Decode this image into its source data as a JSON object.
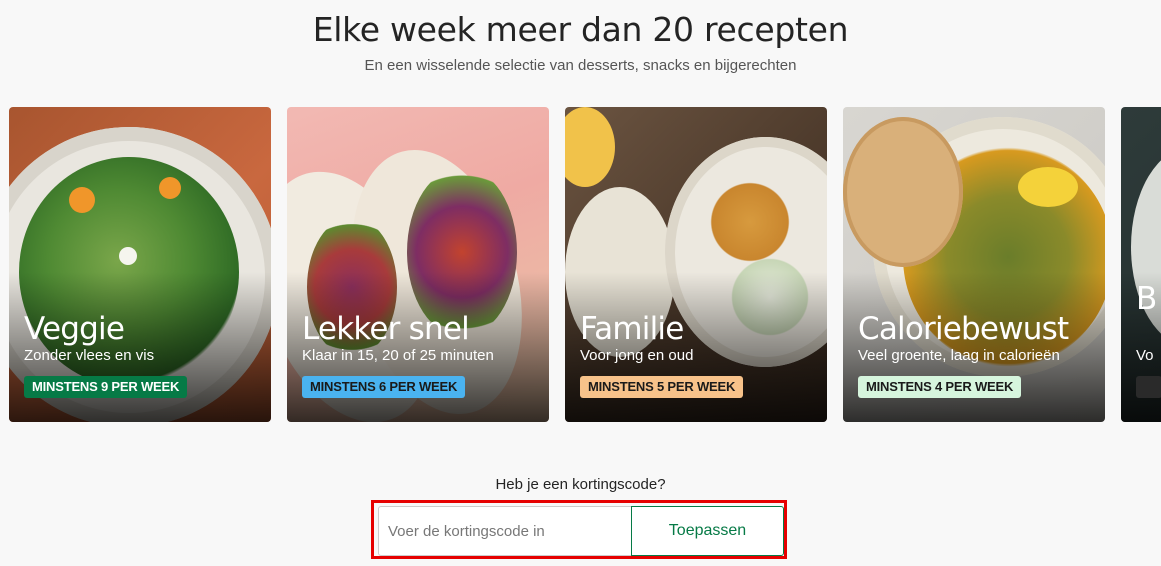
{
  "heading": "Elke week meer dan 20 recepten",
  "subheading": "En een wisselende selectie van desserts, snacks en bijgerechten",
  "cards": [
    {
      "title": "Veggie",
      "description": "Zonder vlees en vis",
      "badge": "MINSTENS 9 PER WEEK",
      "badge_bg": "#067a46",
      "badge_fg": "#ffffff"
    },
    {
      "title": "Lekker snel",
      "description": "Klaar in 15, 20 of 25 minuten",
      "badge": "MINSTENS 6 PER WEEK",
      "badge_bg": "#4ab3f0",
      "badge_fg": "#1a1a1a"
    },
    {
      "title": "Familie",
      "description": "Voor jong en oud",
      "badge": "MINSTENS 5 PER WEEK",
      "badge_bg": "#f7c28a",
      "badge_fg": "#1a1a1a"
    },
    {
      "title": "Caloriebewust",
      "description": "Veel groente, laag in calorieën",
      "badge": "MINSTENS 4 PER WEEK",
      "badge_bg": "#d6f5dd",
      "badge_fg": "#1a1a1a"
    },
    {
      "title": "B",
      "description": "Vo",
      "badge": "",
      "badge_bg": "#2a2a2a",
      "badge_fg": "#ffffff"
    }
  ],
  "discount": {
    "label": "Heb je een kortingscode?",
    "placeholder": "Voer de kortingscode in",
    "button": "Toepassen"
  },
  "colors": {
    "accent_green": "#067a46",
    "highlight_border": "#e60000"
  }
}
